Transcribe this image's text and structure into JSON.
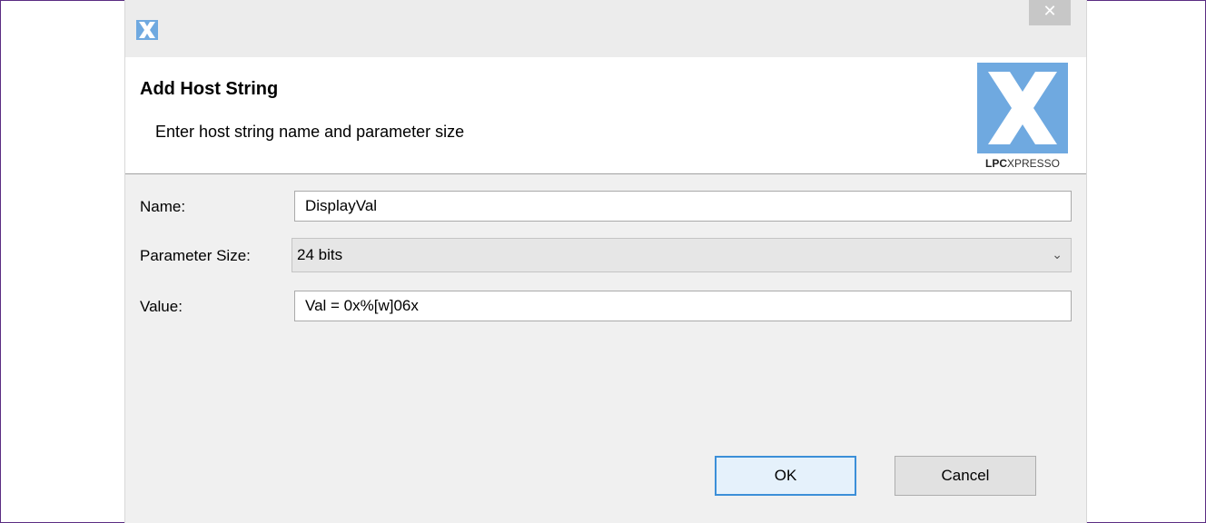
{
  "window": {
    "close_glyph": "✕",
    "app_icon": "lpcxpresso-x-icon"
  },
  "banner": {
    "title": "Add Host String",
    "description": "Enter host string name and parameter size",
    "logo_brand_bold": "LPC",
    "logo_brand_rest": "XPRESSO"
  },
  "form": {
    "name_label": "Name:",
    "name_value": "DisplayVal",
    "param_size_label": "Parameter Size:",
    "param_size_value": "24 bits",
    "value_label": "Value:",
    "value_value": "Val = 0x%[w]06x"
  },
  "buttons": {
    "ok": "OK",
    "cancel": "Cancel"
  },
  "colors": {
    "accent": "#3c8fd8",
    "logo_blue": "#6fa9e0",
    "frame_border": "#5a2d82"
  }
}
